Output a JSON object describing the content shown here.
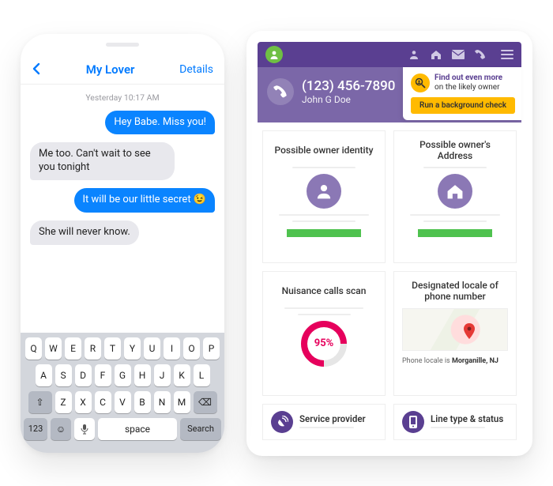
{
  "phone": {
    "nav": {
      "title": "My Lover",
      "details": "Details"
    },
    "timestamp": "Yesterday 10:17 AM",
    "messages": [
      {
        "dir": "out",
        "text": "Hey Babe. Miss you!"
      },
      {
        "dir": "in",
        "text": "Me too. Can't wait to see you tonight"
      },
      {
        "dir": "out",
        "text": "It will be our little secret 😉"
      },
      {
        "dir": "in",
        "text": "She will never know."
      }
    ],
    "keyboard": {
      "row1": [
        "Q",
        "W",
        "E",
        "R",
        "T",
        "Y",
        "U",
        "I",
        "O",
        "P"
      ],
      "row2": [
        "A",
        "S",
        "D",
        "F",
        "G",
        "H",
        "J",
        "K",
        "L"
      ],
      "row3": [
        "Z",
        "X",
        "C",
        "V",
        "B",
        "N",
        "M"
      ],
      "shift": "⇧",
      "backspace": "⌫",
      "num": "123",
      "space": "space",
      "search": "Search",
      "emoji": "☺",
      "mic": "🎤"
    }
  },
  "tablet": {
    "hero": {
      "phone_number": "(123) 456-7890",
      "owner_name": "John G Doe"
    },
    "cta": {
      "line1": "Find out even more",
      "line2": "on the likely owner",
      "button": "Run a background check"
    },
    "cards": {
      "identity_title": "Possible owner identity",
      "address_title": "Possible owner's Address",
      "nuisance_title": "Nuisance calls scan",
      "nuisance_pct": "95%",
      "locale_title": "Designated locale of phone number",
      "locale_label": "Phone locale is ",
      "locale_value": "Morganille, NJ"
    },
    "bottom": {
      "provider_title": "Service provider",
      "linetype_title": "Line type & status"
    },
    "colors": {
      "brand_purple": "#5a3f91",
      "hero_purple": "#7b67a8",
      "accent_green": "#6fbf44",
      "cta_yellow": "#ffba00",
      "donut_pink": "#e6005c"
    }
  }
}
